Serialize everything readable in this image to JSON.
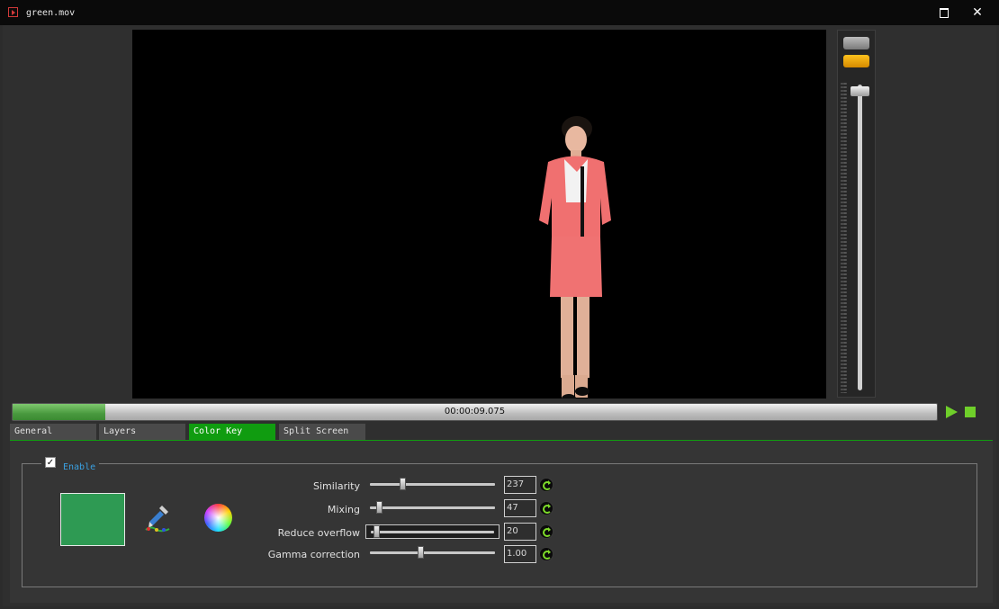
{
  "window": {
    "title": "green.mov",
    "maximize_label": "maximize",
    "close_glyph": "✕"
  },
  "playback": {
    "timecode": "00:00:09.075",
    "progress_fraction": 0.1,
    "volume_fraction": 0.98
  },
  "tabs": [
    {
      "label": "General",
      "active": false
    },
    {
      "label": "Layers",
      "active": false
    },
    {
      "label": "Color Key",
      "active": true
    },
    {
      "label": "Split Screen",
      "active": false
    }
  ],
  "color_key": {
    "enable_label": "Enable",
    "enabled": true,
    "key_color": "#2e9a53",
    "params": [
      {
        "label": "Similarity",
        "value": "237",
        "fraction": 0.25
      },
      {
        "label": "Mixing",
        "value": "47",
        "fraction": 0.05
      },
      {
        "label": "Reduce overflow",
        "value": "20",
        "fraction": 0.02
      },
      {
        "label": "Gamma correction",
        "value": "1.00",
        "fraction": 0.4
      }
    ]
  },
  "colors": {
    "accent_green": "#109c10",
    "play_green": "#6fcf2a",
    "enable_blue": "#3aa0e0",
    "volume_orange": "#ffc21d"
  }
}
